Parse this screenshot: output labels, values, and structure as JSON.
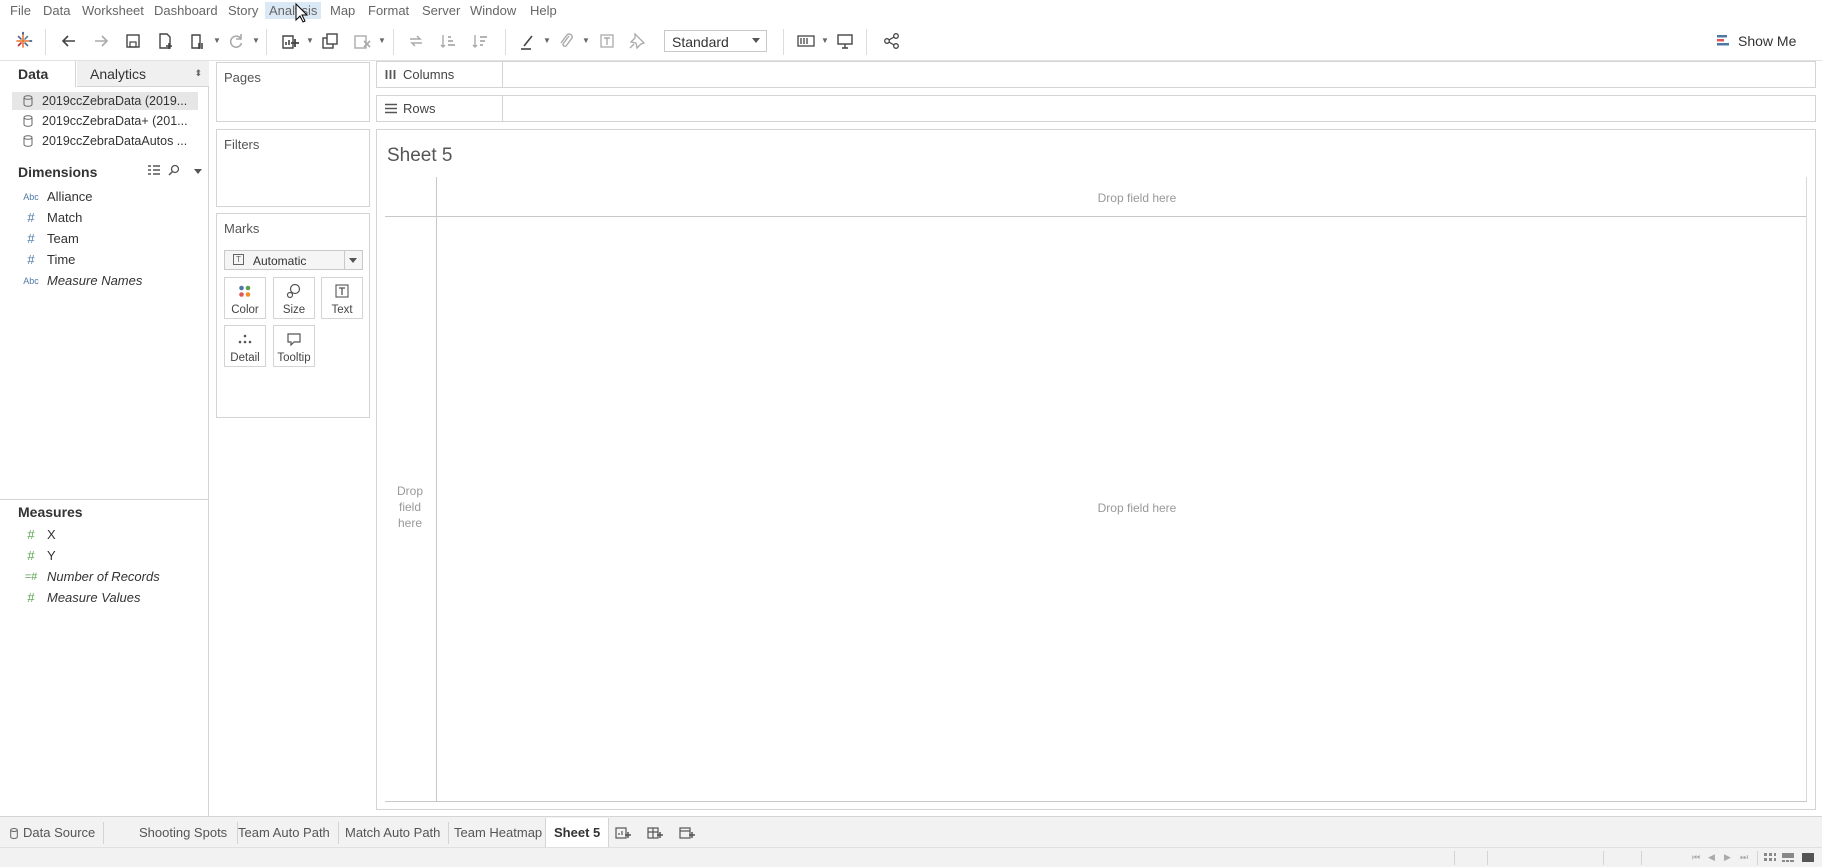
{
  "menu": [
    "File",
    "Data",
    "Worksheet",
    "Dashboard",
    "Story",
    "Analysis",
    "Map",
    "Format",
    "Server",
    "Window",
    "Help"
  ],
  "menu_active": "Analysis",
  "toolbar": {
    "fit": "Standard",
    "show_me": "Show Me",
    "icons": [
      "tableau-logo-icon",
      "undo-icon",
      "redo-icon",
      "save-icon",
      "new-datasource-icon",
      "pause-updates-icon",
      "refresh-icon",
      "new-worksheet-icon",
      "duplicate-sheet-icon",
      "clear-sheet-icon",
      "swap-icon",
      "sort-ascending-icon",
      "sort-descending-icon",
      "highlight-icon",
      "group-icon",
      "labels-icon",
      "pin-icon",
      "show-cards-icon",
      "presentation-icon",
      "share-icon"
    ]
  },
  "data_pane": {
    "tabs": {
      "data": "Data",
      "analytics": "Analytics"
    },
    "datasources": [
      "2019ccZebraData (2019...",
      "2019ccZebraData+ (201...",
      "2019ccZebraDataAutos ..."
    ],
    "dimensions_header": "Dimensions",
    "dimensions": [
      {
        "type": "Abc",
        "name": "Alliance",
        "italic": false
      },
      {
        "type": "#",
        "name": "Match",
        "italic": false
      },
      {
        "type": "#",
        "name": "Team",
        "italic": false
      },
      {
        "type": "#",
        "name": "Time",
        "italic": false
      },
      {
        "type": "Abc",
        "name": "Measure Names",
        "italic": true
      }
    ],
    "measures_header": "Measures",
    "measures": [
      {
        "type": "#",
        "name": "X",
        "italic": false
      },
      {
        "type": "#",
        "name": "Y",
        "italic": false
      },
      {
        "type": "=#",
        "name": "Number of Records",
        "italic": true
      },
      {
        "type": "#",
        "name": "Measure Values",
        "italic": true
      }
    ]
  },
  "cards": {
    "pages": "Pages",
    "filters": "Filters",
    "marks": "Marks",
    "mark_type": "Automatic",
    "mark_buttons": [
      "Color",
      "Size",
      "Text",
      "Detail",
      "Tooltip"
    ]
  },
  "shelves": {
    "columns": "Columns",
    "rows": "Rows"
  },
  "view": {
    "title": "Sheet 5",
    "drop_top": "Drop field here",
    "drop_center": "Drop field here",
    "drop_left": [
      "Drop",
      "field",
      "here"
    ]
  },
  "sheet_tabs": [
    "Data Source",
    "Shooting Spots",
    "Team Auto Path",
    "Match Auto Path",
    "Team Heatmap",
    "Sheet 5"
  ],
  "active_sheet": "Sheet 5"
}
